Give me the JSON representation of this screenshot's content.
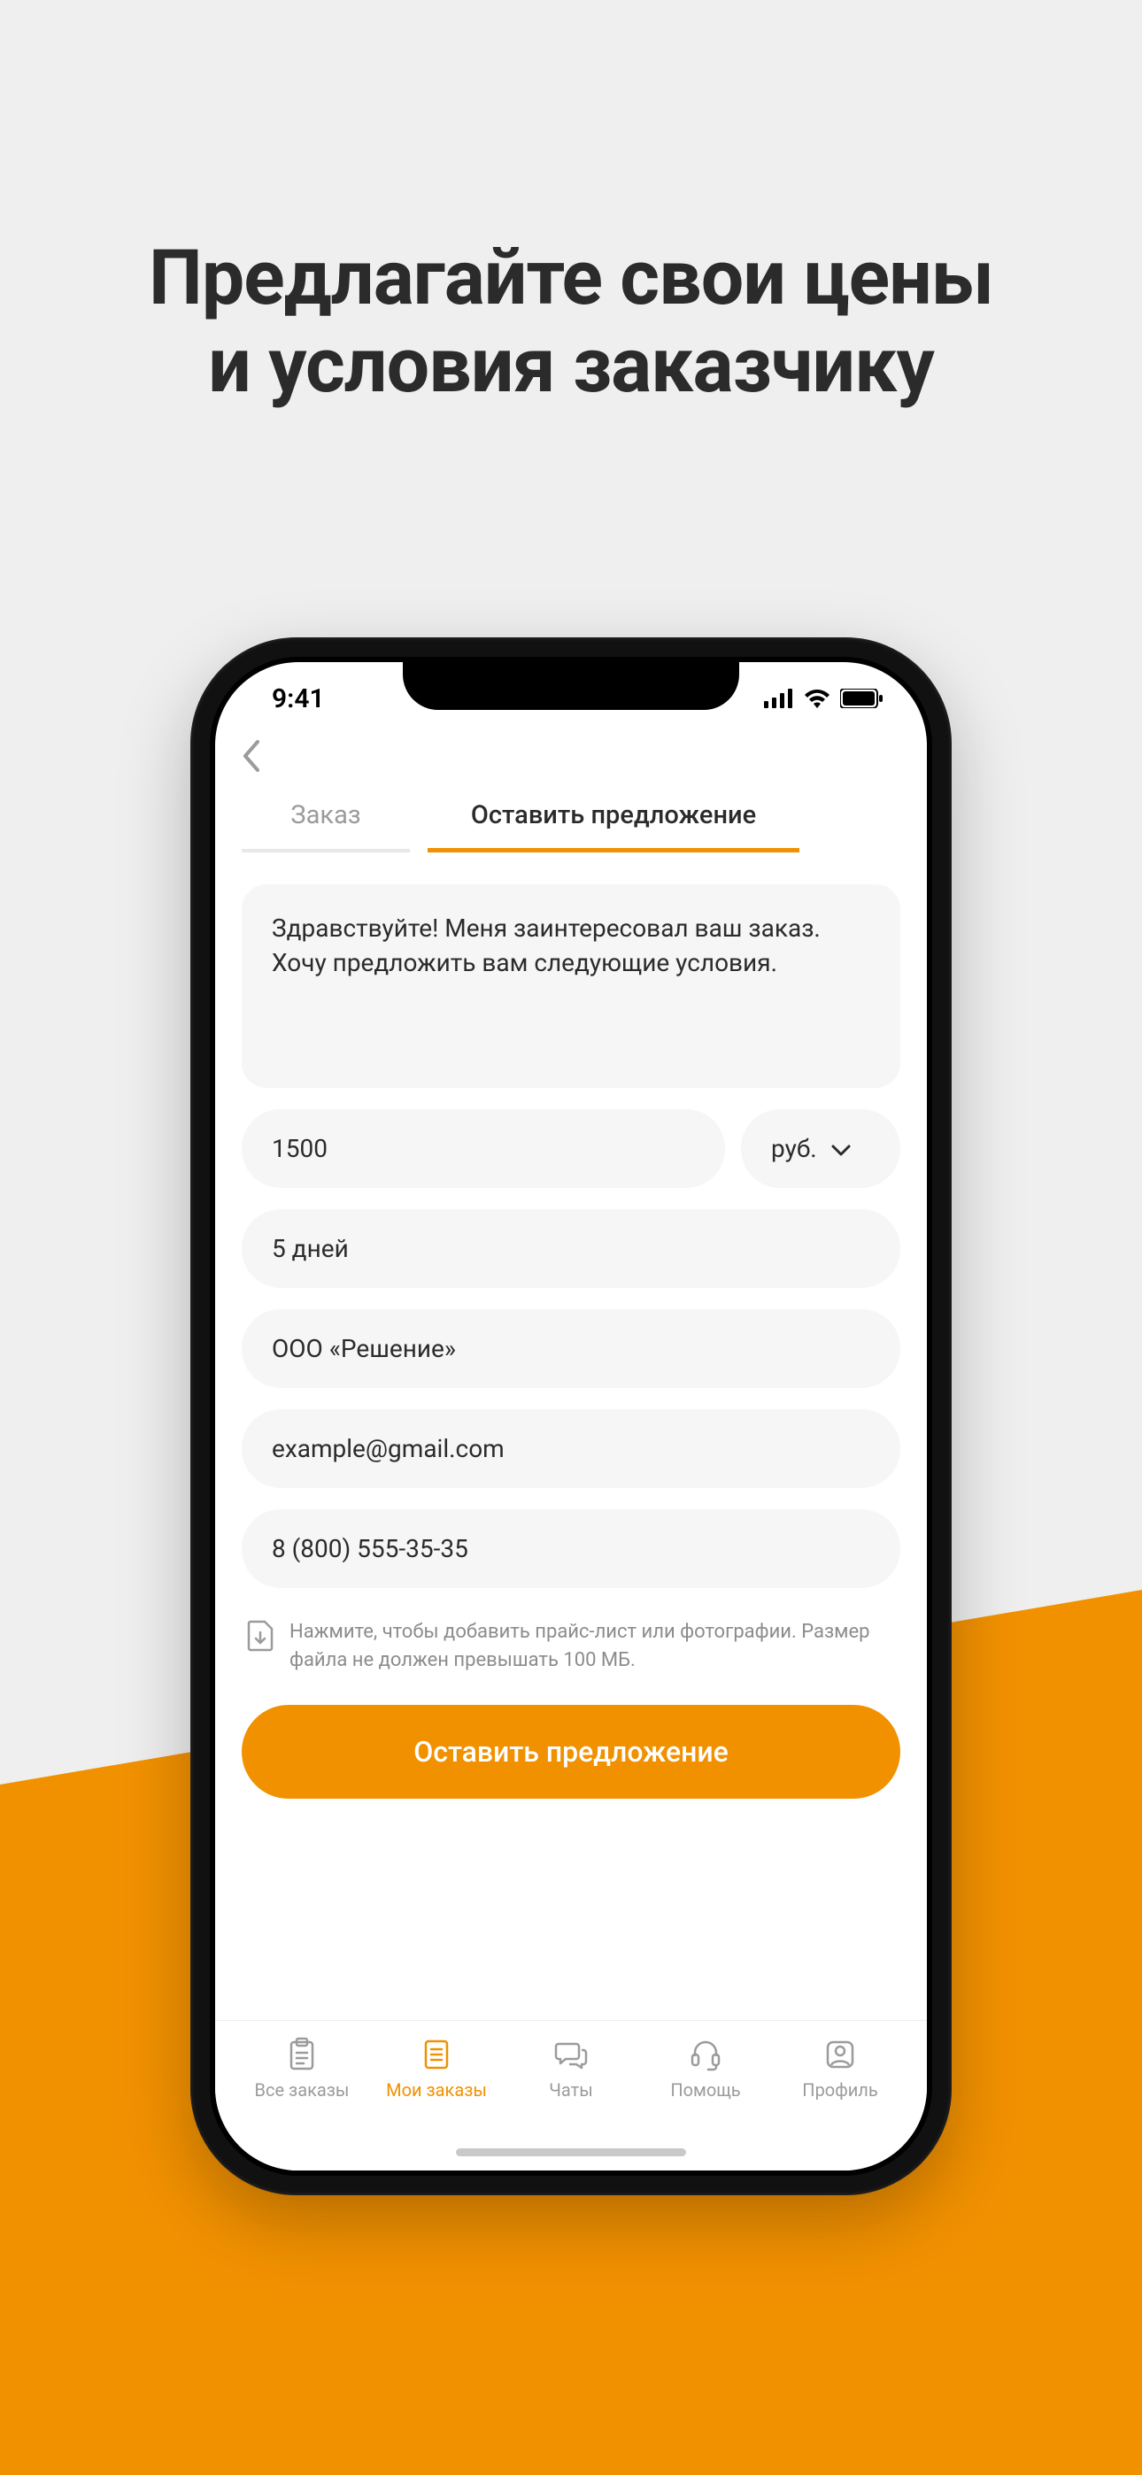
{
  "marketing": {
    "headline_line1": "Предлагайте свои цены",
    "headline_line2": "и условия заказчику"
  },
  "status": {
    "time": "9:41"
  },
  "tabs": {
    "order": "Заказ",
    "offer": "Оставить предложение"
  },
  "form": {
    "message": "Здравствуйте! Меня заинтересовал ваш заказ. Хочу предложить вам следующие условия.",
    "price": "1500",
    "currency": "руб.",
    "duration": "5 дней",
    "company": "ООО «Решение»",
    "email": "example@gmail.com",
    "phone": "8 (800) 555-35-35",
    "upload_hint": "Нажмите, чтобы добавить прайс-лист или фотографии. Размер файла не должен превышать 100 МБ.",
    "submit": "Оставить предложение"
  },
  "tabbar": {
    "all_orders": "Все заказы",
    "my_orders": "Мои заказы",
    "chats": "Чаты",
    "help": "Помощь",
    "profile": "Профиль"
  }
}
